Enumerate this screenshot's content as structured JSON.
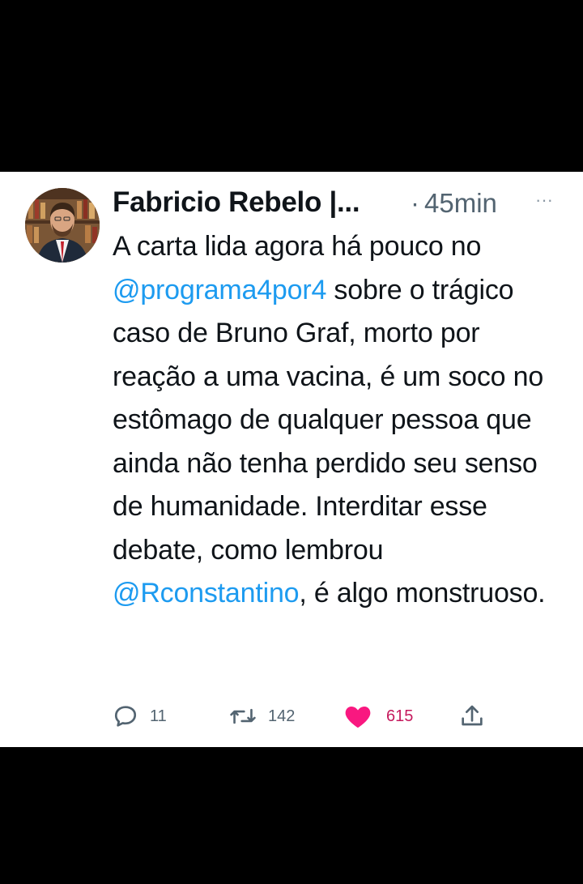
{
  "tweet": {
    "author_name": "Fabricio Rebelo |...",
    "time_separator": "·",
    "timestamp": "45min",
    "more_label": "···",
    "text_parts": {
      "p1": "A carta lida agora há pouco no ",
      "mention1": "@programa4por4",
      "p2": " sobre o trágico caso de Bruno Graf, morto por reação a uma vacina, é um soco no estômago de qualquer pessoa que ainda não tenha perdido seu senso de humanidade. Interditar esse debate, como lembrou ",
      "mention2": "@Rconstantino",
      "p3": ", é algo monstruoso."
    },
    "actions": {
      "reply_count": "11",
      "retweet_count": "142",
      "like_count": "615"
    }
  },
  "colors": {
    "link": "#1d9bf0",
    "like": "#f91880",
    "secondary_text": "#536471"
  },
  "icons": [
    "avatar-photo",
    "more-icon",
    "reply-icon",
    "retweet-icon",
    "heart-icon",
    "share-icon"
  ]
}
